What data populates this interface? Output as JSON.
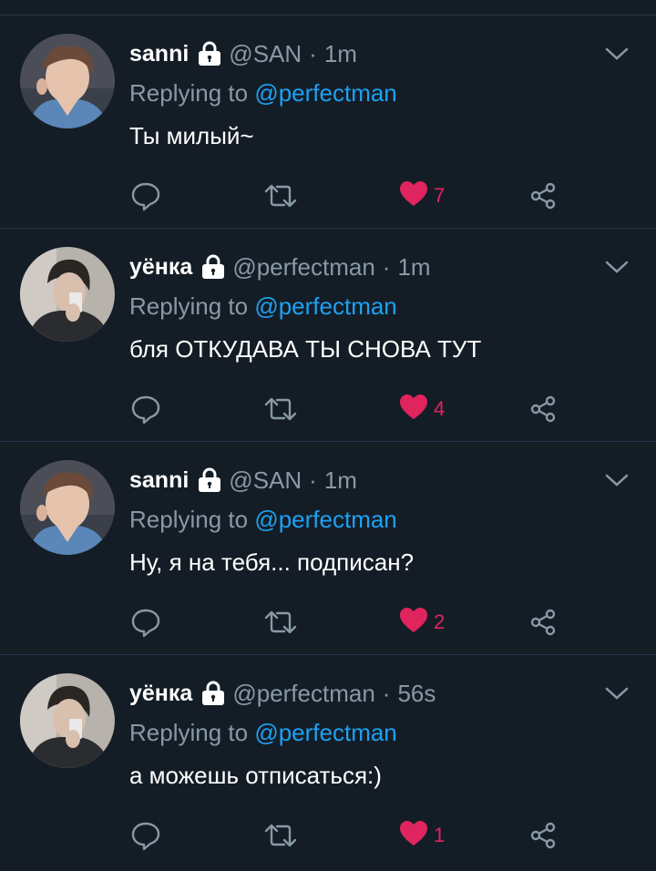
{
  "colors": {
    "background": "#141d26",
    "divider": "#243447",
    "muted": "#8899a6",
    "link": "#1da1f2",
    "like": "#e0245e",
    "text": "#ffffff"
  },
  "tweets": [
    {
      "name": "sanni",
      "handle": "@SAN",
      "separator": "·",
      "time": "1m",
      "reply_prefix": "Replying to ",
      "reply_to": "@perfectman",
      "text": "Ты милый~",
      "likes": "7",
      "avatar": "avatar-sanni",
      "icons": [
        "lock-icon",
        "chevron-down-icon",
        "reply-icon",
        "retweet-icon",
        "heart-icon",
        "share-icon"
      ]
    },
    {
      "name": "уёнка",
      "handle": "@perfectman",
      "separator": "·",
      "time": "1m",
      "reply_prefix": "Replying to ",
      "reply_to": "@perfectman",
      "text": "бля ОТКУДАВА ТЫ СНОВА ТУТ",
      "likes": "4",
      "avatar": "avatar-yeonka",
      "icons": [
        "lock-icon",
        "chevron-down-icon",
        "reply-icon",
        "retweet-icon",
        "heart-icon",
        "share-icon"
      ]
    },
    {
      "name": "sanni",
      "handle": "@SAN",
      "separator": "·",
      "time": "1m",
      "reply_prefix": "Replying to ",
      "reply_to": "@perfectman",
      "text": "Ну, я на тебя... подписан?",
      "likes": "2",
      "avatar": "avatar-sanni",
      "icons": [
        "lock-icon",
        "chevron-down-icon",
        "reply-icon",
        "retweet-icon",
        "heart-icon",
        "share-icon"
      ]
    },
    {
      "name": "уёнка",
      "handle": "@perfectman",
      "separator": "·",
      "time": "56s",
      "reply_prefix": "Replying to ",
      "reply_to": "@perfectman",
      "text": "а можешь отписаться:)",
      "likes": "1",
      "avatar": "avatar-yeonka",
      "icons": [
        "lock-icon",
        "chevron-down-icon",
        "reply-icon",
        "retweet-icon",
        "heart-icon",
        "share-icon"
      ]
    }
  ]
}
